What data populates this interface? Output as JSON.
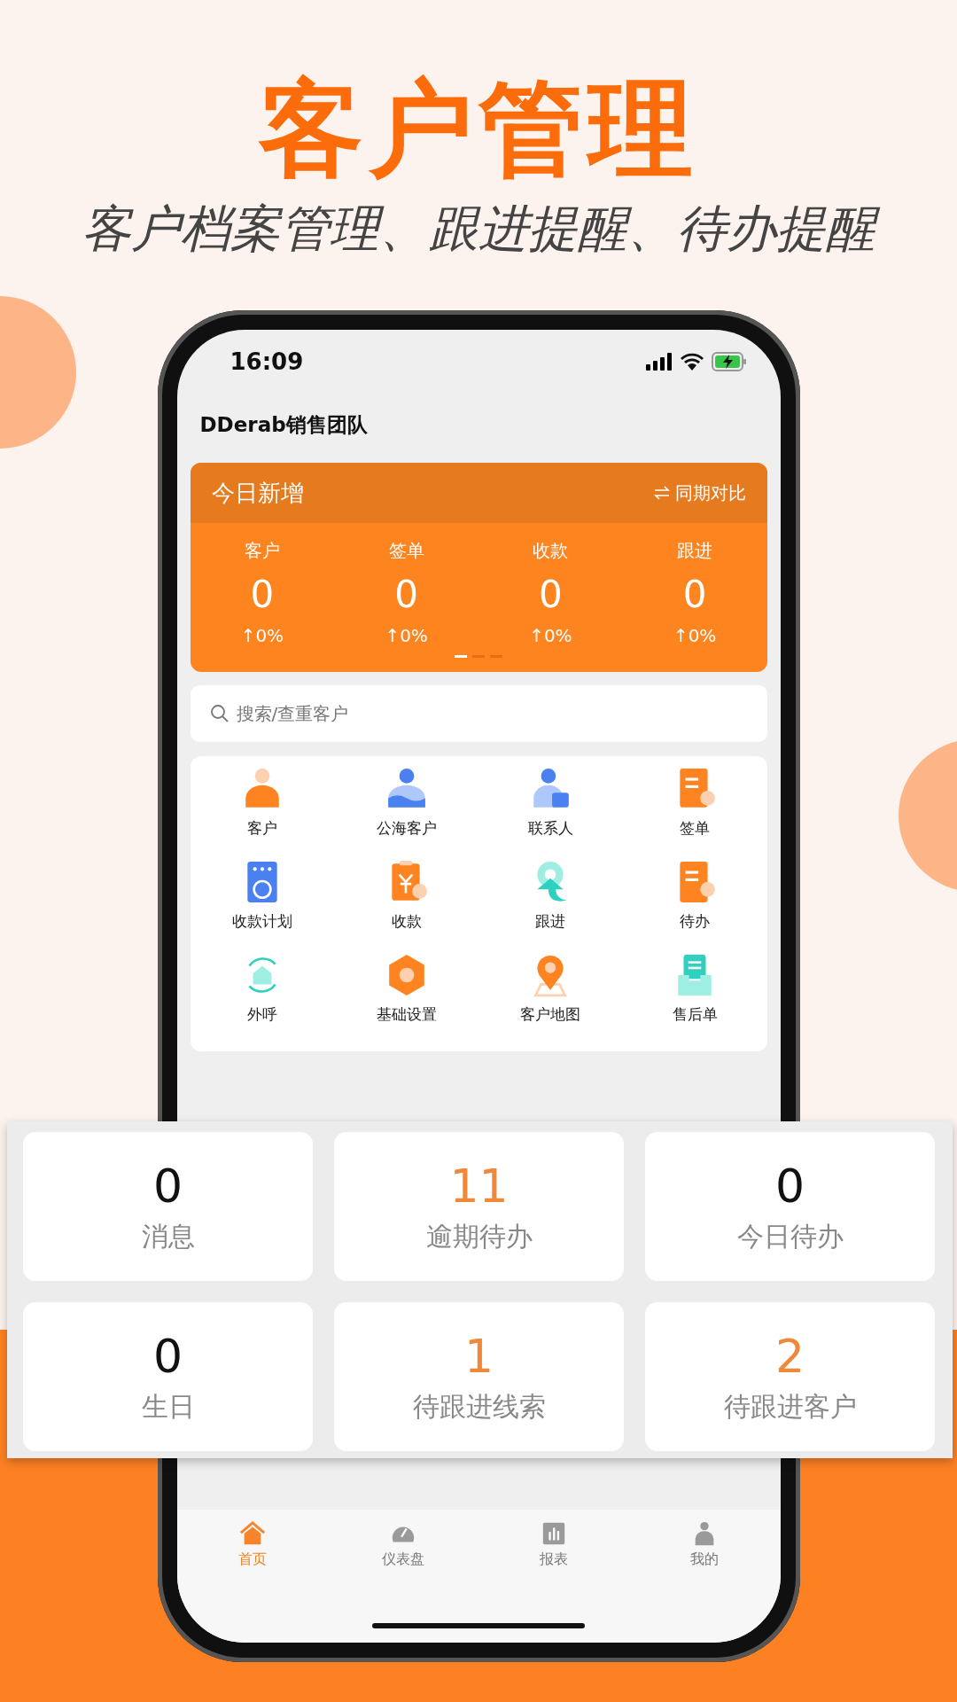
{
  "banner": {
    "title": "客户管理",
    "subtitle": "客户档案管理、跟进提醒、待办提醒"
  },
  "status_bar": {
    "time": "16:09"
  },
  "header": {
    "title": "DDerab销售团队"
  },
  "today_card": {
    "title": "今日新增",
    "compare": "同期对比",
    "stats": [
      {
        "label": "客户",
        "value": "0",
        "change": "↑0%"
      },
      {
        "label": "签单",
        "value": "0",
        "change": "↑0%"
      },
      {
        "label": "收款",
        "value": "0",
        "change": "↑0%"
      },
      {
        "label": "跟进",
        "value": "0",
        "change": "↑0%"
      }
    ],
    "pager": [
      {
        "selected": true
      },
      {
        "selected": false
      },
      {
        "selected": false
      }
    ]
  },
  "search": {
    "placeholder": "搜索/查重客户"
  },
  "shortcuts": [
    {
      "label": "客户"
    },
    {
      "label": "公海客户"
    },
    {
      "label": "联系人"
    },
    {
      "label": "签单"
    },
    {
      "label": "收款计划"
    },
    {
      "label": "收款"
    },
    {
      "label": "跟进"
    },
    {
      "label": "待办"
    },
    {
      "label": "外呼"
    },
    {
      "label": "基础设置"
    },
    {
      "label": "客户地图"
    },
    {
      "label": "售后单"
    }
  ],
  "reminders": [
    {
      "value": "0",
      "label": "消息",
      "color": "#111111"
    },
    {
      "value": "11",
      "label": "逾期待办",
      "color": "#f0883a"
    },
    {
      "value": "0",
      "label": "今日待办",
      "color": "#111111"
    },
    {
      "value": "0",
      "label": "生日",
      "color": "#111111"
    },
    {
      "value": "1",
      "label": "待跟进线索",
      "color": "#f0883a"
    },
    {
      "value": "2",
      "label": "待跟进客户",
      "color": "#f0883a"
    }
  ],
  "tab_bar": [
    {
      "label": "首页",
      "selected": true
    },
    {
      "label": "仪表盘",
      "selected": false
    },
    {
      "label": "报表",
      "selected": false
    },
    {
      "label": "我的",
      "selected": false
    }
  ]
}
